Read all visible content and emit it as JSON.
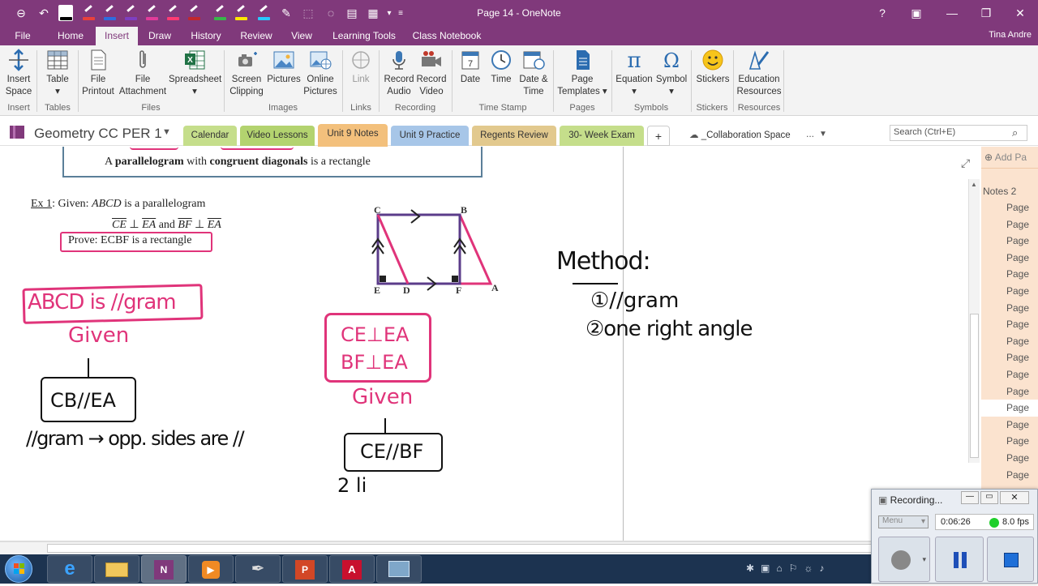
{
  "window": {
    "title": "Page 14 - OneNote",
    "controls": [
      "?",
      "▣",
      "—",
      "❐",
      "✕"
    ]
  },
  "ribbon_tabs": [
    "File",
    "Home",
    "Insert",
    "Draw",
    "History",
    "Review",
    "View",
    "Learning Tools",
    "Class Notebook"
  ],
  "active_tab": "Insert",
  "user": "Tina Andre",
  "ribbon": {
    "buttons": [
      {
        "label1": "Insert",
        "label2": "Space"
      },
      {
        "label1": "Table",
        "label2": "▾"
      },
      {
        "label1": "File",
        "label2": "Printout"
      },
      {
        "label1": "File",
        "label2": "Attachment"
      },
      {
        "label1": "Spreadsheet",
        "label2": "▾"
      },
      {
        "label1": "Screen",
        "label2": "Clipping"
      },
      {
        "label1": "Pictures",
        "label2": ""
      },
      {
        "label1": "Online",
        "label2": "Pictures"
      },
      {
        "label1": "Link",
        "label2": ""
      },
      {
        "label1": "Record",
        "label2": "Audio"
      },
      {
        "label1": "Record",
        "label2": "Video"
      },
      {
        "label1": "Date",
        "label2": ""
      },
      {
        "label1": "Time",
        "label2": ""
      },
      {
        "label1": "Date &",
        "label2": "Time"
      },
      {
        "label1": "Page",
        "label2": "Templates ▾"
      },
      {
        "label1": "Equation",
        "label2": "▾"
      },
      {
        "label1": "Symbol",
        "label2": "▾"
      },
      {
        "label1": "Stickers",
        "label2": ""
      },
      {
        "label1": "Education",
        "label2": "Resources"
      }
    ],
    "groups": [
      "Insert",
      "Tables",
      "Files",
      "Images",
      "Links",
      "Recording",
      "Time Stamp",
      "Pages",
      "Symbols",
      "Stickers",
      "Resources"
    ]
  },
  "notebook": {
    "name": "Geometry CC PER 1",
    "sections": [
      {
        "label": "Calendar",
        "color": "#c5de8b"
      },
      {
        "label": "Video Lessons",
        "color": "#b3d36f"
      },
      {
        "label": "Unit 9 Notes",
        "color": "#f3c07c"
      },
      {
        "label": "Unit 9 Practice",
        "color": "#a7c6e8"
      },
      {
        "label": "Regents Review",
        "color": "#e2c98e"
      },
      {
        "label": "30- Week Exam",
        "color": "#c5de8b"
      },
      {
        "label": "+",
        "color": "#ffffff"
      }
    ],
    "collab": "_Collaboration Space",
    "more": "...",
    "search_placeholder": "Search (Ctrl+E)"
  },
  "page_pane": {
    "add_page": "Add Pa",
    "items": [
      "Notes 2",
      "Page",
      "Page",
      "Page",
      "Page",
      "Page",
      "Page",
      "Page",
      "Page",
      "Page",
      "Page",
      "Page",
      "Page",
      "Page",
      "Page",
      "Page",
      "Page",
      "Page"
    ],
    "selected_index": 13
  },
  "content": {
    "theorem": {
      "a": "A ",
      "b": "parallelogram",
      "c": " with ",
      "d": "congruent diagonals",
      "e": " is a rectangle"
    },
    "example": {
      "ex": "Ex 1",
      "given_prefix": ": Given: ",
      "abcd": "ABCD",
      "given_suffix": " is a parallelogram"
    },
    "perp": {
      "ce": "CE",
      "perp1": " ⊥ ",
      "ea1": "EA",
      "and": " and ",
      "bf": "BF",
      "perp2": " ⊥ ",
      "ea2": "EA"
    },
    "prove": "Prove: ECBF is a rectangle",
    "figure_labels": {
      "c": "C",
      "b": "B",
      "e": "E",
      "d": "D",
      "f": "F",
      "a": "A"
    },
    "ink": {
      "stmt1": "ABCD is //gram",
      "reason1": "Given",
      "stmt2": "CB//EA",
      "reason2": "//gram → opp. sides are //",
      "stmt3a": "CE⊥EA",
      "stmt3b": "BF⊥EA",
      "reason3": "Given",
      "stmt4": "CE//BF",
      "stmt5": "2 li",
      "method": "Method:",
      "m1": "①//gram",
      "m2": "②one right angle"
    }
  },
  "recorder": {
    "title": "Recording...",
    "menu": "Menu",
    "time": "0:06:26",
    "fps": "8.0 fps"
  }
}
